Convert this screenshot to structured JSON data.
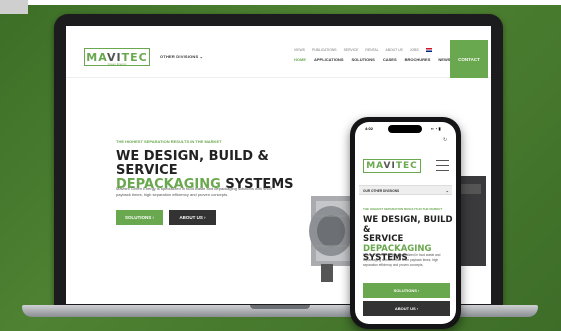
{
  "brand": {
    "logo_text_green": "MA",
    "logo_text_dark": "VI",
    "logo_text_green2": "TEC",
    "logo_sub": "Green Energy",
    "color_green": "#6aa84f",
    "color_dark": "#333333"
  },
  "laptop": {
    "header": {
      "divisions_label": "OTHER DIVISIONS",
      "util_nav": [
        "VIEWS",
        "PUBLICATIONS",
        "SERVICE",
        "RENTAL",
        "ABOUT US",
        "JOBS"
      ],
      "main_nav": [
        "HOME",
        "APPLICATIONS",
        "SOLUTIONS",
        "CASES",
        "BROCHURES",
        "NEWS"
      ],
      "contact_label": "CONTACT"
    },
    "hero": {
      "eyebrow": "THE HIGHEST SEPARATION RESULTS IN THE MARKET",
      "title_line1": "WE DESIGN, BUILD & SERVICE",
      "title_line2": "DEPACKAGING",
      "title_line2_rest": " SYSTEMS",
      "description": "Mavitec Green Energy is specialized in food waste and depackaging solutions with short payback times, high separation efficiency and proven concepts.",
      "btn_solutions": "SOLUTIONS  ›",
      "btn_about": "ABOUT US  ›"
    }
  },
  "phone": {
    "time": "4:02",
    "status_icons": "▪▪ ◔ ▮",
    "divisions_label": "OUR OTHER DIVISIONS",
    "eyebrow": "THE HIGHEST SEPARATION RESULTS IN THE MARKET",
    "title_line1": "WE DESIGN, BUILD &",
    "title_line2_a": "SERVICE ",
    "title_line2_b": "DEPACKAGING",
    "title_line3": "SYSTEMS",
    "description": "Mavitec Green Energy is specialized in food waste and depackaging solutions with short payback times, high separation efficiency and proven concepts.",
    "btn_solutions": "SOLUTIONS  ›",
    "btn_about": "ABOUT US  ›"
  }
}
